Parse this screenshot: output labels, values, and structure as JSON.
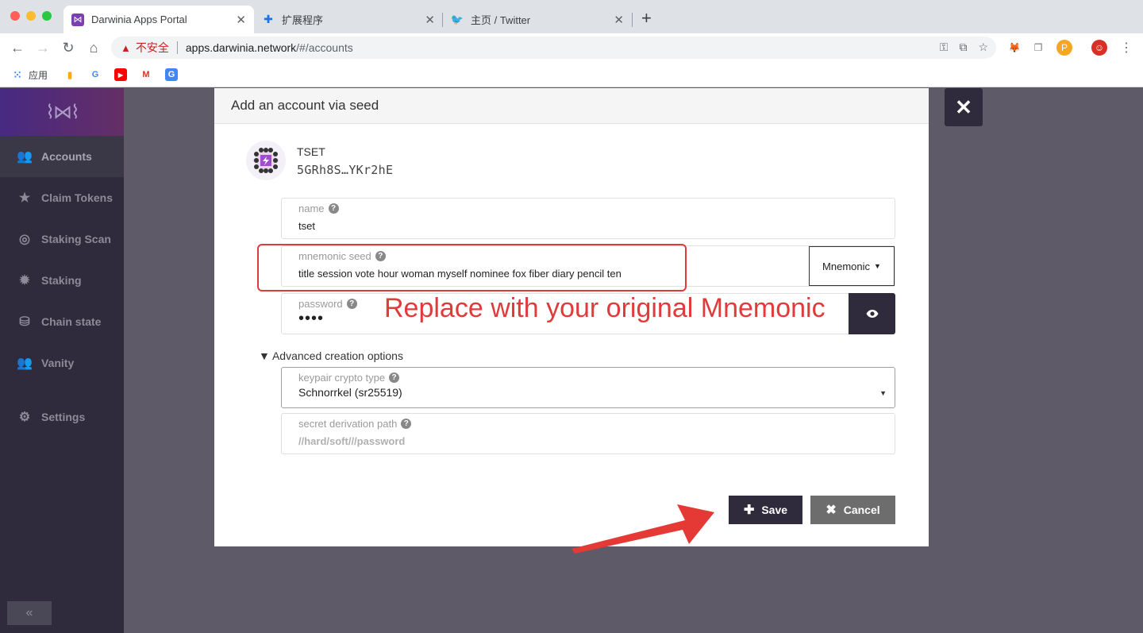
{
  "browser": {
    "tabs": [
      {
        "title": "Darwinia Apps Portal",
        "active": true
      },
      {
        "title": "扩展程序",
        "active": false
      },
      {
        "title": "主页 / Twitter",
        "active": false
      }
    ],
    "security_label": "不安全",
    "url_host": "apps.darwinia.network",
    "url_path": "/#/accounts",
    "bookmarks": {
      "apps_label": "应用"
    }
  },
  "sidebar": {
    "items": [
      {
        "label": "Accounts",
        "icon": "users-icon",
        "active": true
      },
      {
        "label": "Claim Tokens",
        "icon": "star-icon"
      },
      {
        "label": "Staking Scan",
        "icon": "target-icon"
      },
      {
        "label": "Staking",
        "icon": "gear-icon"
      },
      {
        "label": "Chain state",
        "icon": "database-icon"
      },
      {
        "label": "Vanity",
        "icon": "users-icon"
      },
      {
        "label": "Settings",
        "icon": "cogs-icon"
      }
    ],
    "collapse_label": "«"
  },
  "modal": {
    "title": "Add an account via seed",
    "account": {
      "name": "TSET",
      "address": "5GRh8S…YKr2hE"
    },
    "name_field": {
      "label": "name",
      "value": "tset"
    },
    "seed_field": {
      "label": "mnemonic seed",
      "value": "title session vote hour woman myself nominee fox fiber diary pencil ten",
      "type_option": "Mnemonic"
    },
    "password_field": {
      "label": "password",
      "value": "••••"
    },
    "advanced_label": "▼ Advanced creation options",
    "crypto_field": {
      "label": "keypair crypto type",
      "value": "Schnorrkel (sr25519)"
    },
    "derivation_field": {
      "label": "secret derivation path",
      "placeholder": "//hard/soft///password"
    },
    "save_label": "Save",
    "cancel_label": "Cancel"
  },
  "annotation": {
    "text": "Replace with your original Mnemonic",
    "color": "#e03a3a"
  },
  "colors": {
    "accent_dark": "#2f2b3c",
    "sidebar_bg": "#2f2b3c",
    "annotation_red": "#e03a3a"
  }
}
